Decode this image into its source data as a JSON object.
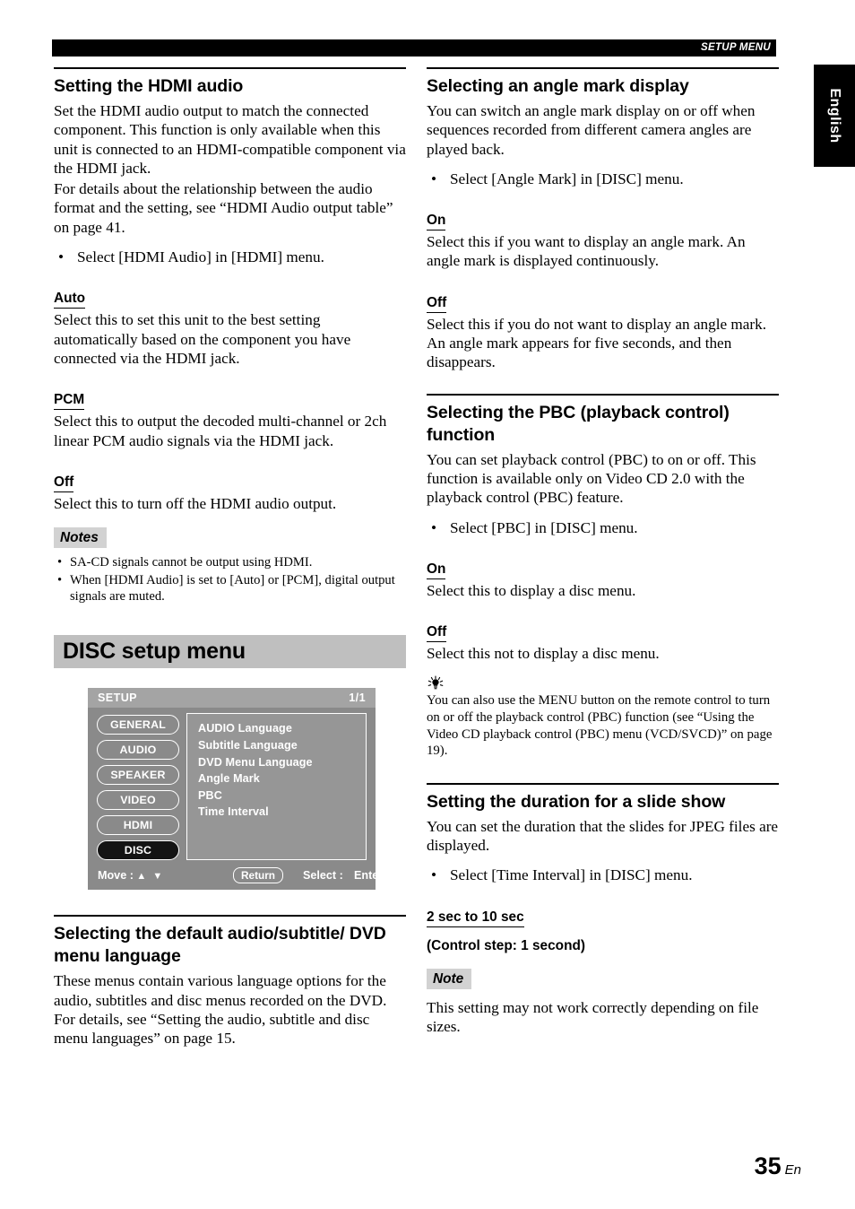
{
  "running_head": {
    "label": "SETUP MENU"
  },
  "language_tab": {
    "label": "English"
  },
  "left_column": {
    "section_hdmi_audio": {
      "heading": "Setting the HDMI audio",
      "para1": "Set the HDMI audio output to match the connected component. This function is only available when this unit is connected to an HDMI-compatible component via the HDMI jack.",
      "para2": "For details about the relationship between the audio format and the setting, see “HDMI Audio output table” on page 41.",
      "bullet_dot": "•",
      "bullet": "Select [HDMI Audio] in [HDMI] menu.",
      "options": [
        {
          "name": "Auto",
          "text": "Select this to set this unit to the best setting automatically based on the component you have connected via the HDMI jack."
        },
        {
          "name": "PCM",
          "text": "Select this to output the decoded multi-channel or 2ch linear PCM audio signals via the HDMI jack."
        },
        {
          "name": "Off",
          "text": "Select this to turn off the HDMI audio output."
        }
      ],
      "notes_label": "Notes",
      "notes": [
        "SA-CD signals cannot be output using HDMI.",
        "When [HDMI Audio] is set to [Auto] or [PCM], digital output signals are muted."
      ],
      "note_dot": "•"
    },
    "banner": {
      "title": "DISC setup menu"
    },
    "osd": {
      "title": "SETUP",
      "page_indicator": "1/1",
      "tabs": [
        {
          "label": "GENERAL",
          "selected": false
        },
        {
          "label": "AUDIO",
          "selected": false
        },
        {
          "label": "SPEAKER",
          "selected": false
        },
        {
          "label": "VIDEO",
          "selected": false
        },
        {
          "label": "HDMI",
          "selected": false
        },
        {
          "label": "DISC",
          "selected": true
        }
      ],
      "items": [
        "AUDIO Language",
        "Subtitle Language",
        "DVD Menu Language",
        "Angle Mark",
        "PBC",
        "Time Interval"
      ],
      "footer": {
        "move_label": "Move :",
        "move_arrows": "▲ ▼",
        "return_button": "Return",
        "select_label": "Select :",
        "enter_label": "Enter"
      }
    },
    "section_language": {
      "heading": "Selecting the default audio/subtitle/ DVD menu language",
      "para1": "These menus contain various language options for the audio, subtitles and disc menus recorded on the DVD. For details, see “Setting the audio, subtitle and disc menu languages” on page 15."
    }
  },
  "right_column": {
    "section_angle_mark": {
      "heading": "Selecting an angle mark display",
      "para1": "You can switch an angle mark display on or off when sequences recorded from different camera angles are played back.",
      "bullet_dot": "•",
      "bullet": "Select [Angle Mark] in [DISC] menu.",
      "options": [
        {
          "name": "On",
          "text": "Select this if you want to display an angle mark. An angle mark is displayed continuously."
        },
        {
          "name": "Off",
          "text": "Select this if you do not want to display an angle mark. An angle mark appears for five seconds, and then disappears."
        }
      ]
    },
    "section_pbc": {
      "heading": "Selecting the PBC (playback control) function",
      "para1": "You can set playback control (PBC) to on or off. This function is available only on Video CD 2.0 with the playback control (PBC) feature.",
      "bullet_dot": "•",
      "bullet": "Select [PBC] in [DISC] menu.",
      "options": [
        {
          "name": "On",
          "text": "Select this to display a disc menu."
        },
        {
          "name": "Off",
          "text": "Select this not to display a disc menu."
        }
      ],
      "tip": "You can also use the MENU button on the remote control to turn on or off the playback control (PBC) function (see “Using the Video CD playback control (PBC) menu (VCD/SVCD)” on page 19)."
    },
    "section_slide_show": {
      "heading": "Setting the duration for a slide show",
      "para1": "You can set the duration that the slides for JPEG files are displayed.",
      "bullet_dot": "•",
      "bullet": "Select [Time Interval] in [DISC] menu.",
      "range_label": "2 sec to 10 sec",
      "step_label": "(Control step: 1 second)",
      "note_label": "Note",
      "note_text": "This setting may not work correctly depending on file sizes."
    }
  },
  "footer": {
    "page_number": "35",
    "page_suffix": "En"
  }
}
